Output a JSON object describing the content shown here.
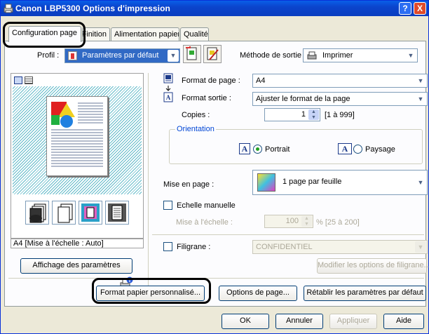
{
  "window": {
    "title": "Canon LBP5300 Options d'impression",
    "help_glyph": "?",
    "close_glyph": "X"
  },
  "tabs": [
    {
      "label": "Configuration page"
    },
    {
      "label": "Finition"
    },
    {
      "label": "Alimentation papier"
    },
    {
      "label": "Qualité"
    }
  ],
  "profile": {
    "label": "Profil :",
    "value": "Paramètres par défaut"
  },
  "output_method": {
    "label": "Méthode de sortie :",
    "value": "Imprimer"
  },
  "preview": {
    "caption": "A4 [Mise à l'échelle : Auto]",
    "show_settings_button": "Affichage des paramètres"
  },
  "page_size": {
    "label": "Format de page :",
    "value": "A4"
  },
  "output_size": {
    "label": "Format sortie :",
    "value": "Ajuster le format de la page"
  },
  "copies": {
    "label": "Copies :",
    "value": "1",
    "range": "[1 à 999]"
  },
  "orientation": {
    "label": "Orientation",
    "portrait": "Portrait",
    "landscape": "Paysage",
    "selected": "Portrait",
    "glyph": "A"
  },
  "layout": {
    "label": "Mise en page :",
    "value": "1 page par feuille"
  },
  "manual_scaling": {
    "label": "Echelle manuelle",
    "checked": false
  },
  "scaling": {
    "label": "Mise à l'échelle :",
    "value": "100",
    "range": "% [25 à 200]"
  },
  "watermark": {
    "label": "Filigrane :",
    "checked": false,
    "value": "CONFIDENTIEL",
    "edit_button": "Modifier les options de filigrane..."
  },
  "bottom_buttons": {
    "custom_paper": "Format papier personnalisé...",
    "page_options": "Options de page...",
    "restore_defaults": "Rétablir les paramètres par défaut"
  },
  "dialog_buttons": {
    "ok": "OK",
    "cancel": "Annuler",
    "apply": "Appliquer",
    "help": "Aide"
  },
  "colors": {
    "titlebar": "#0a4fd8",
    "highlight": "#000000",
    "radio_dot": "#21a121"
  }
}
